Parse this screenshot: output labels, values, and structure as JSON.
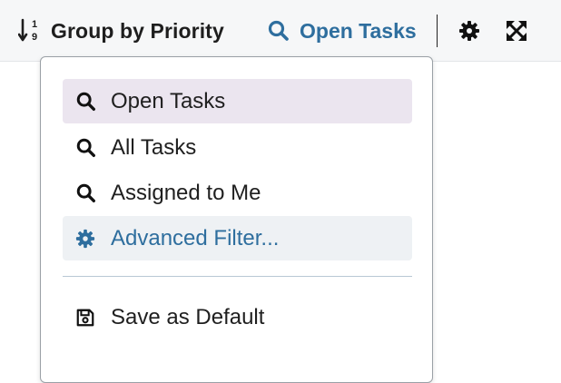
{
  "toolbar": {
    "group_label": "Group by Priority",
    "sort_icon_digits": {
      "top": "1",
      "bottom": "9"
    },
    "filter_label": "Open Tasks",
    "accent_color": "#2e6e9e"
  },
  "menu": {
    "items": [
      {
        "label": "Open Tasks",
        "icon": "search-icon",
        "selected": true
      },
      {
        "label": "All Tasks",
        "icon": "search-icon",
        "selected": false
      },
      {
        "label": "Assigned to Me",
        "icon": "search-icon",
        "selected": false
      },
      {
        "label": "Advanced Filter...",
        "icon": "gear-icon",
        "hovered": true
      }
    ],
    "save_label": "Save as Default",
    "save_icon": "save-icon",
    "selected_bg": "#ebe5ef",
    "hover_bg": "#eef1f4"
  }
}
